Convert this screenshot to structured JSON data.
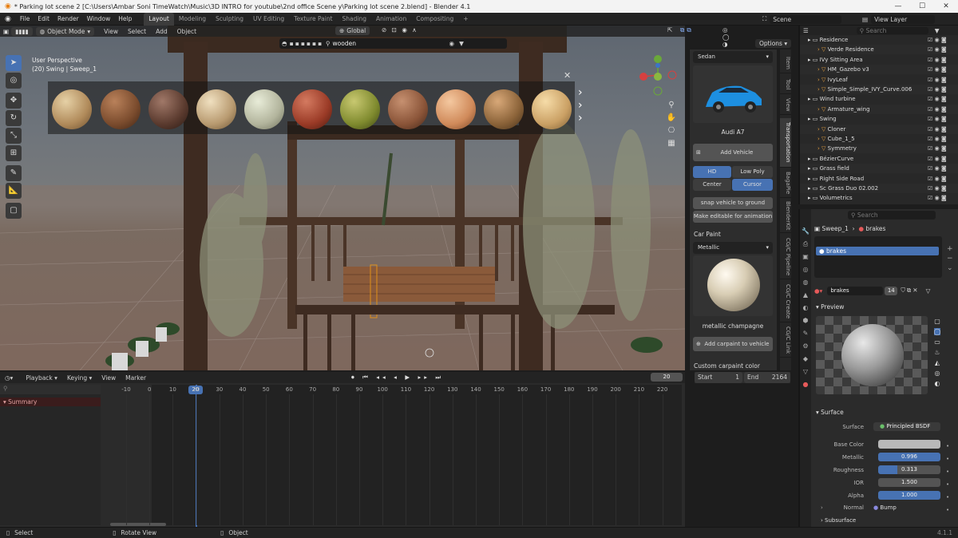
{
  "window": {
    "title": "* Parking lot scene 2 [C:\\Users\\Ambar Soni TimeWatch\\Music\\3D INTRO for youtube\\2nd office Scene y\\Parking lot scene 2.blend] - Blender 4.1"
  },
  "menu": {
    "items": [
      "File",
      "Edit",
      "Render",
      "Window",
      "Help"
    ]
  },
  "workspaces": {
    "tabs": [
      "Layout",
      "Modeling",
      "Sculpting",
      "UV Editing",
      "Texture Paint",
      "Shading",
      "Animation",
      "Compositing"
    ],
    "add": "+",
    "active": 0
  },
  "top_right": {
    "scene_label": "Scene",
    "view_layer_label": "View Layer"
  },
  "viewport": {
    "mode": "Object Mode",
    "menus": [
      "View",
      "Select",
      "Add",
      "Object"
    ],
    "transform": "Global",
    "search_value": "wooden",
    "options_label": "Options",
    "overlay_line1": "User Perspective",
    "overlay_line2": "(20) Swing | Sweep_1"
  },
  "npanel": {
    "category": "Sedan",
    "car_name": "Audi A7",
    "add_vehicle": "Add Vehicle",
    "hd": "HD",
    "low_poly": "Low Poly",
    "center": "Center",
    "cursor": "Cursor",
    "snap": "snap vehicle to ground",
    "editable": "Make editable for animation",
    "car_paint_label": "Car Paint",
    "paint_type": "Metallic",
    "paint_name": "metallic champagne",
    "add_carpaint": "Add carpaint to vehicle",
    "custom_color": "Custom carpaint color",
    "tabs": [
      "Item",
      "Tool",
      "View",
      "Transportation",
      "BagaPie",
      "BlenderKit",
      "CG/C Pipeline",
      "CG/C Create",
      "CG/C Link"
    ]
  },
  "outliner": {
    "search_placeholder": "Search",
    "rows": [
      {
        "label": "Residence",
        "depth": 0
      },
      {
        "label": "Verde Residence",
        "depth": 1
      },
      {
        "label": "IVy Sitting Area",
        "depth": 0
      },
      {
        "label": "HM_Gazebo v3",
        "depth": 1
      },
      {
        "label": "IvyLeaf",
        "depth": 1
      },
      {
        "label": "Simple_Simple_IVY_Curve.006",
        "depth": 1
      },
      {
        "label": "Wind turbine",
        "depth": 0
      },
      {
        "label": "Armature_wing",
        "depth": 1
      },
      {
        "label": "Swing",
        "depth": 0
      },
      {
        "label": "Cloner",
        "depth": 1
      },
      {
        "label": "Cube_1_5",
        "depth": 1
      },
      {
        "label": "Symmetry",
        "depth": 1
      },
      {
        "label": "BézierCurve",
        "depth": 0
      },
      {
        "label": "Grass field",
        "depth": 0
      },
      {
        "label": "Right Side Road",
        "depth": 0
      },
      {
        "label": "Sc Grass Duo 02.002",
        "depth": 0
      },
      {
        "label": "Volumetrics",
        "depth": 0
      }
    ]
  },
  "properties": {
    "search_placeholder": "Search",
    "breadcrumb_object": "Sweep_1",
    "breadcrumb_material": "brakes",
    "slot_name": "brakes",
    "material_name": "brakes",
    "users": "14",
    "preview_label": "Preview",
    "surface_label": "Surface",
    "surface_key": "Surface",
    "surface_value": "Principled BSDF",
    "base_color_key": "Base Color",
    "base_color": "#b8b8b8",
    "metallic_key": "Metallic",
    "metallic": "0.996",
    "roughness_key": "Roughness",
    "roughness": "0.313",
    "ior_key": "IOR",
    "ior": "1.500",
    "alpha_key": "Alpha",
    "alpha": "1.000",
    "normal_key": "Normal",
    "normal_value": "Bump",
    "subsurface_label": "Subsurface"
  },
  "timeline": {
    "menus": [
      "Playback",
      "Keying",
      "View",
      "Marker"
    ],
    "current_frame": "20",
    "start_label": "Start",
    "start": "1",
    "end_label": "End",
    "end": "2164",
    "summary_label": "Summary",
    "ticks": [
      "-10",
      "0",
      "10",
      "20",
      "30",
      "40",
      "50",
      "60",
      "70",
      "80",
      "90",
      "100",
      "110",
      "120",
      "130",
      "140",
      "150",
      "160",
      "170",
      "180",
      "190",
      "200",
      "210",
      "220"
    ]
  },
  "statusbar": {
    "select": "Select",
    "rotate": "Rotate View",
    "object": "Object",
    "version": "4.1.1"
  }
}
